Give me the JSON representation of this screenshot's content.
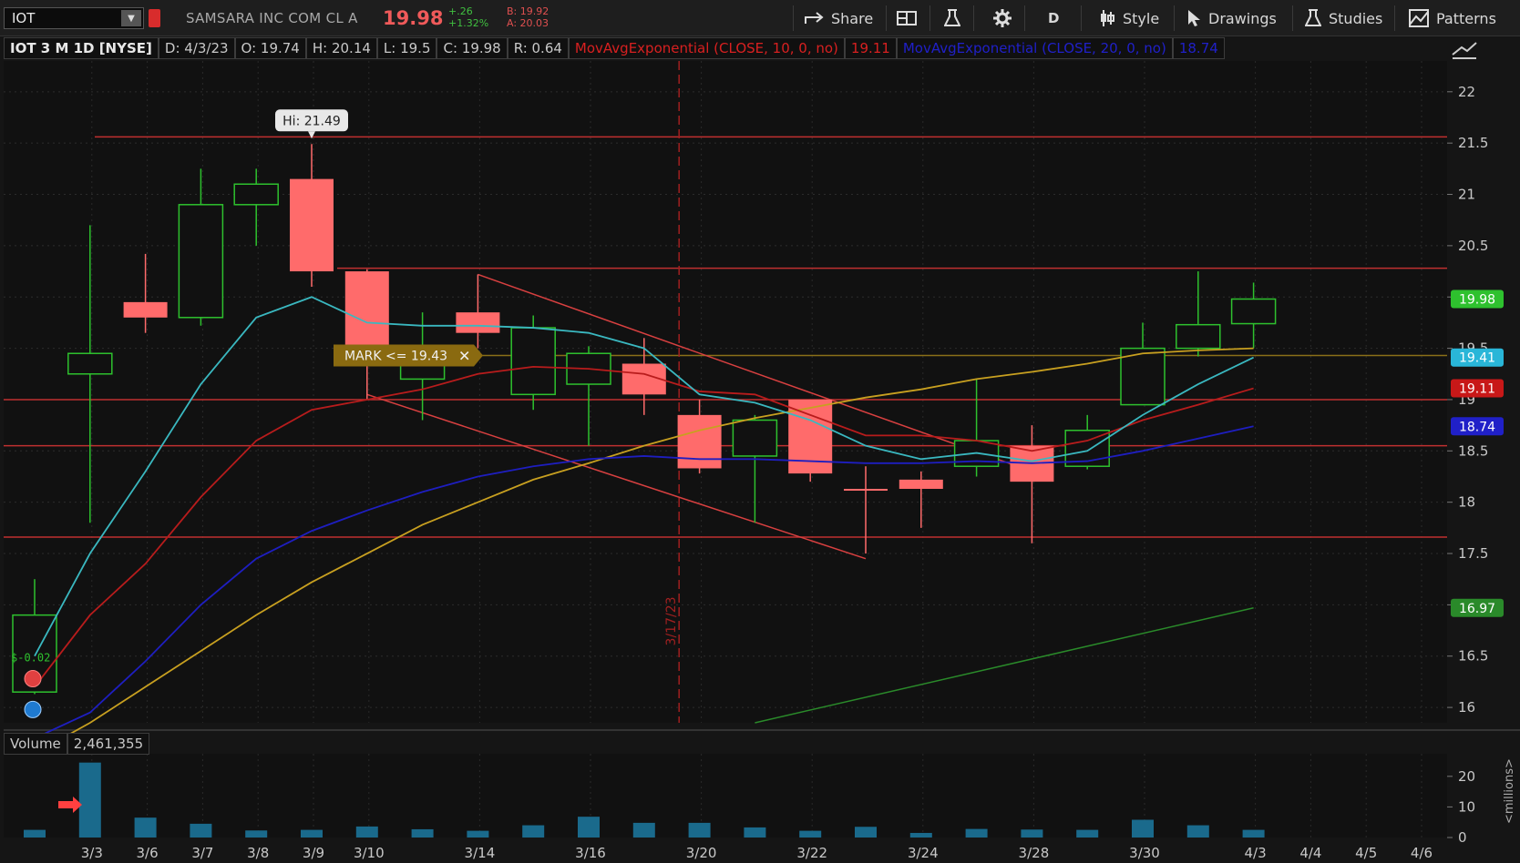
{
  "toolbar": {
    "symbol": "IOT",
    "company": "SAMSARA INC COM CL A",
    "last": "19.98",
    "change": "+.26",
    "change_pct": "+1.32%",
    "bid": "B: 19.92",
    "ask": "A: 20.03",
    "share_label": "Share",
    "period_label": "D",
    "style_label": "Style",
    "drawings_label": "Drawings",
    "studies_label": "Studies",
    "patterns_label": "Patterns"
  },
  "info_bar": {
    "title": "IOT 3 M 1D [NYSE]",
    "date": "D: 4/3/23",
    "open": "O: 19.74",
    "high": "H: 20.14",
    "low": "L: 19.5",
    "close": "C: 19.98",
    "range": "R: 0.64",
    "ema10_label": "MovAvgExponential (CLOSE, 10, 0, no)",
    "ema10_value": "19.11",
    "ema20_label": "MovAvgExponential (CLOSE, 20, 0, no)",
    "ema20_value": "18.74"
  },
  "volume_panel": {
    "label": "Volume",
    "value": "2,461,355",
    "unit_label": "<millions>",
    "ticks": [
      "20",
      "10",
      "0"
    ]
  },
  "annotations": {
    "hi_label": "Hi: 21.49",
    "mark_order": "MARK <= 19.43",
    "event_date": "3/17/23",
    "dividend_note": "$-0.02"
  },
  "colors": {
    "up": "#2ec12e",
    "down": "#ff6b6b",
    "ema10": "#b81c1c",
    "ema20": "#1e1ec0",
    "ema5": "#3ab8c0",
    "ma_gold": "#c8a020",
    "trend_red": "#d84040",
    "trend_green": "#2a8a2a",
    "volume": "#1a6a8c",
    "last_badge": "#2ec12e",
    "mark_badge": "#29b6d8",
    "ema10_badge": "#c81818",
    "ema20_badge": "#2020c8",
    "order_badge": "#8a6a10"
  },
  "chart_data": {
    "type": "candlestick",
    "symbol": "IOT",
    "aggregation": "1D",
    "ylim": [
      15.85,
      22.3
    ],
    "y_ticks": [
      16,
      16.5,
      17,
      17.5,
      18,
      18.5,
      19,
      19.5,
      20,
      20.5,
      21,
      21.5,
      22
    ],
    "x_tick_labels": [
      "3/3",
      "3/6",
      "3/7",
      "3/8",
      "3/9",
      "3/10",
      "3/14",
      "3/16",
      "3/20",
      "3/22",
      "3/24",
      "3/28",
      "3/30",
      "4/3",
      "4/4",
      "4/5",
      "4/6"
    ],
    "price_badges": [
      {
        "label": "19.98",
        "value": 19.98,
        "role": "last"
      },
      {
        "label": "19.41",
        "value": 19.41,
        "role": "mark"
      },
      {
        "label": "19.11",
        "value": 19.11,
        "role": "ema10"
      },
      {
        "label": "18.74",
        "value": 18.74,
        "role": "ema20"
      },
      {
        "label": "16.97",
        "value": 16.97,
        "role": "trend"
      }
    ],
    "candles": [
      {
        "date": "3/2",
        "open": 16.15,
        "high": 17.25,
        "low": 16.13,
        "close": 16.9
      },
      {
        "date": "3/3",
        "open": 19.25,
        "high": 20.7,
        "low": 17.8,
        "close": 19.45
      },
      {
        "date": "3/6",
        "open": 19.95,
        "high": 20.42,
        "low": 19.65,
        "close": 19.8
      },
      {
        "date": "3/7",
        "open": 19.8,
        "high": 21.25,
        "low": 19.72,
        "close": 20.9
      },
      {
        "date": "3/8",
        "open": 20.9,
        "high": 21.25,
        "low": 20.5,
        "close": 21.1
      },
      {
        "date": "3/9",
        "open": 21.15,
        "high": 21.49,
        "low": 20.1,
        "close": 20.25
      },
      {
        "date": "3/10",
        "open": 20.25,
        "high": 20.27,
        "low": 19.0,
        "close": 19.5
      },
      {
        "date": "3/13",
        "open": 19.2,
        "high": 19.85,
        "low": 18.8,
        "close": 19.48
      },
      {
        "date": "3/14",
        "open": 19.85,
        "high": 20.22,
        "low": 19.5,
        "close": 19.65
      },
      {
        "date": "3/15",
        "open": 19.05,
        "high": 19.82,
        "low": 18.9,
        "close": 19.7
      },
      {
        "date": "3/16",
        "open": 19.15,
        "high": 19.52,
        "low": 18.55,
        "close": 19.45
      },
      {
        "date": "3/17",
        "open": 19.35,
        "high": 19.6,
        "low": 18.85,
        "close": 19.05
      },
      {
        "date": "3/20",
        "open": 18.85,
        "high": 19.0,
        "low": 18.28,
        "close": 18.33
      },
      {
        "date": "3/21",
        "open": 18.45,
        "high": 18.85,
        "low": 17.8,
        "close": 18.8
      },
      {
        "date": "3/22",
        "open": 19.0,
        "high": 19.0,
        "low": 18.2,
        "close": 18.28
      },
      {
        "date": "3/23",
        "open": 18.13,
        "high": 18.35,
        "low": 17.5,
        "close": 18.12
      },
      {
        "date": "3/24",
        "open": 18.22,
        "high": 18.3,
        "low": 17.75,
        "close": 18.13
      },
      {
        "date": "3/27",
        "open": 18.35,
        "high": 19.2,
        "low": 18.25,
        "close": 18.6
      },
      {
        "date": "3/28",
        "open": 18.55,
        "high": 18.75,
        "low": 17.6,
        "close": 18.2
      },
      {
        "date": "3/29",
        "open": 18.35,
        "high": 18.85,
        "low": 18.32,
        "close": 18.7
      },
      {
        "date": "3/30",
        "open": 18.95,
        "high": 19.75,
        "low": 18.95,
        "close": 19.5
      },
      {
        "date": "3/31",
        "open": 19.5,
        "high": 20.25,
        "low": 19.42,
        "close": 19.73
      },
      {
        "date": "4/3",
        "open": 19.74,
        "high": 20.14,
        "low": 19.5,
        "close": 19.98
      }
    ],
    "volume_millions": [
      2.5,
      24.5,
      6.5,
      4.5,
      2.3,
      2.5,
      3.6,
      2.7,
      2.2,
      4.0,
      6.8,
      4.8,
      4.8,
      3.3,
      2.2,
      3.5,
      1.5,
      2.8,
      2.6,
      2.5,
      5.8,
      4.0,
      2.5
    ],
    "ema5": [
      16.5,
      17.5,
      18.3,
      19.15,
      19.8,
      20.0,
      19.75,
      19.72,
      19.72,
      19.7,
      19.65,
      19.5,
      19.05,
      18.97,
      18.8,
      18.55,
      18.42,
      18.48,
      18.4,
      18.5,
      18.85,
      19.15,
      19.41
    ],
    "ema10": [
      16.2,
      16.9,
      17.4,
      18.05,
      18.6,
      18.9,
      19.0,
      19.1,
      19.25,
      19.32,
      19.3,
      19.25,
      19.08,
      19.05,
      18.85,
      18.65,
      18.65,
      18.6,
      18.5,
      18.6,
      18.8,
      18.95,
      19.11
    ],
    "ema20": [
      15.7,
      15.95,
      16.45,
      17.0,
      17.45,
      17.72,
      17.92,
      18.1,
      18.25,
      18.35,
      18.42,
      18.45,
      18.42,
      18.42,
      18.4,
      18.38,
      18.38,
      18.4,
      18.38,
      18.4,
      18.5,
      18.62,
      18.74
    ],
    "ma_gold": [
      15.55,
      15.85,
      16.2,
      16.55,
      16.9,
      17.22,
      17.5,
      17.78,
      18.0,
      18.22,
      18.38,
      18.55,
      18.7,
      18.82,
      18.92,
      19.02,
      19.1,
      19.2,
      19.27,
      19.35,
      19.45,
      19.48,
      19.5
    ],
    "horizontal_levels": [
      21.56,
      20.28,
      19.43,
      19.0,
      18.55,
      17.66
    ],
    "trendlines": [
      {
        "from": {
          "date": "3/14",
          "price": 20.22
        },
        "to": {
          "date": "3/28",
          "price": 18.3
        },
        "color": "red"
      },
      {
        "from": {
          "date": "3/10",
          "price": 19.05
        },
        "to": {
          "date": "3/23",
          "price": 17.45
        },
        "color": "red"
      },
      {
        "from": {
          "date": "3/21",
          "price": 15.85
        },
        "to": {
          "date": "4/3",
          "price": 16.97
        },
        "color": "green"
      }
    ]
  }
}
